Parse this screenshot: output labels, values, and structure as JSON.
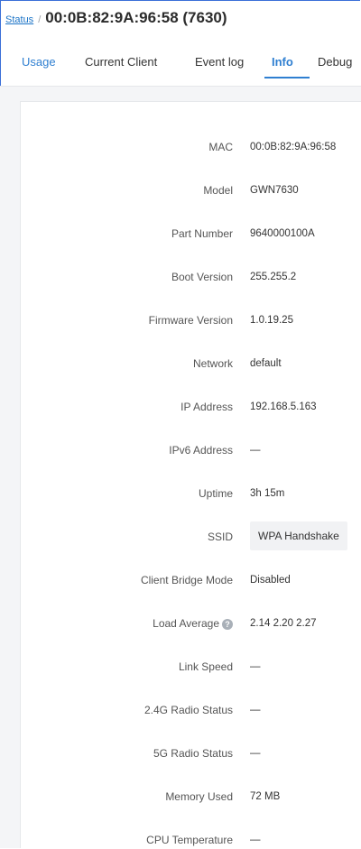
{
  "header": {
    "breadcrumb_link": "Status",
    "separator": "/",
    "title": "00:0B:82:9A:96:58 (7630)"
  },
  "tabs": [
    {
      "label": "Usage"
    },
    {
      "label": "Current Client"
    },
    {
      "label": "Event log"
    },
    {
      "label": "Info"
    },
    {
      "label": "Debug"
    }
  ],
  "active_tab": "Info",
  "info": {
    "mac": {
      "label": "MAC",
      "value": "00:0B:82:9A:96:58"
    },
    "model": {
      "label": "Model",
      "value": "GWN7630"
    },
    "part_number": {
      "label": "Part Number",
      "value": "9640000100A"
    },
    "boot_version": {
      "label": "Boot Version",
      "value": "255.255.2"
    },
    "firmware_version": {
      "label": "Firmware Version",
      "value": "1.0.19.25"
    },
    "network": {
      "label": "Network",
      "value": "default"
    },
    "ip_address": {
      "label": "IP Address",
      "value": "192.168.5.163"
    },
    "ipv6_address": {
      "label": "IPv6 Address",
      "value": "—"
    },
    "uptime": {
      "label": "Uptime",
      "value": "3h 15m"
    },
    "ssid": {
      "label": "SSID",
      "value": "WPA Handshake"
    },
    "client_bridge_mode": {
      "label": "Client Bridge Mode",
      "value": "Disabled"
    },
    "load_average": {
      "label": "Load Average",
      "value": "2.14 2.20 2.27"
    },
    "link_speed": {
      "label": "Link Speed",
      "value": "—"
    },
    "radio_24g_status": {
      "label": "2.4G Radio Status",
      "value": "—"
    },
    "radio_5g_status": {
      "label": "5G Radio Status",
      "value": "—"
    },
    "memory_used": {
      "label": "Memory Used",
      "value": "72 MB"
    },
    "cpu_temperature": {
      "label": "CPU Temperature",
      "value": "—"
    }
  },
  "icons": {
    "load_average_help": "question-icon"
  },
  "colors": {
    "accent": "#2f7fd1",
    "frame_border": "#3a6fd8",
    "page_background": "#f4f5f7"
  }
}
